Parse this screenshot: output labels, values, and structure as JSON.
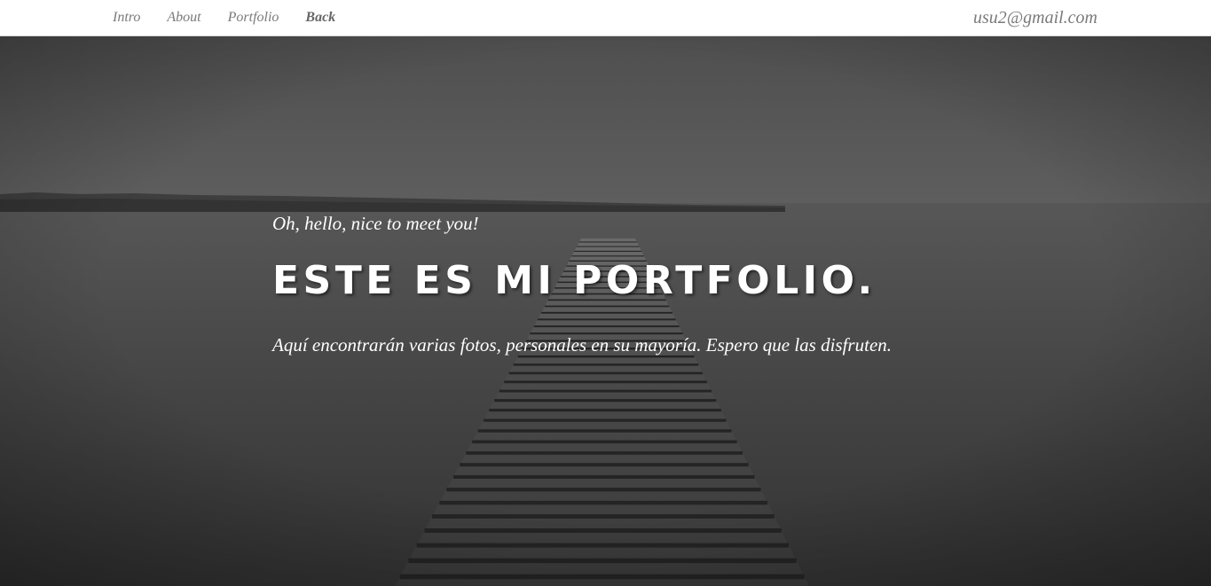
{
  "nav": {
    "links": [
      {
        "label": "Intro"
      },
      {
        "label": "About"
      },
      {
        "label": "Portfolio"
      },
      {
        "label": "Back"
      }
    ],
    "email": "usu2@gmail.com"
  },
  "hero": {
    "greeting": "Oh, hello, nice to meet you!",
    "title": "ESTE ES MI PORTFOLIO.",
    "subtitle": "Aquí encontrarán varias fotos, personales en su mayoría. Espero que las disfruten.",
    "background_image": "pier-over-lake-grayscale"
  },
  "colors": {
    "nav_background": "#ffffff",
    "nav_text": "#7a7a7a",
    "hero_text": "#ffffff"
  }
}
